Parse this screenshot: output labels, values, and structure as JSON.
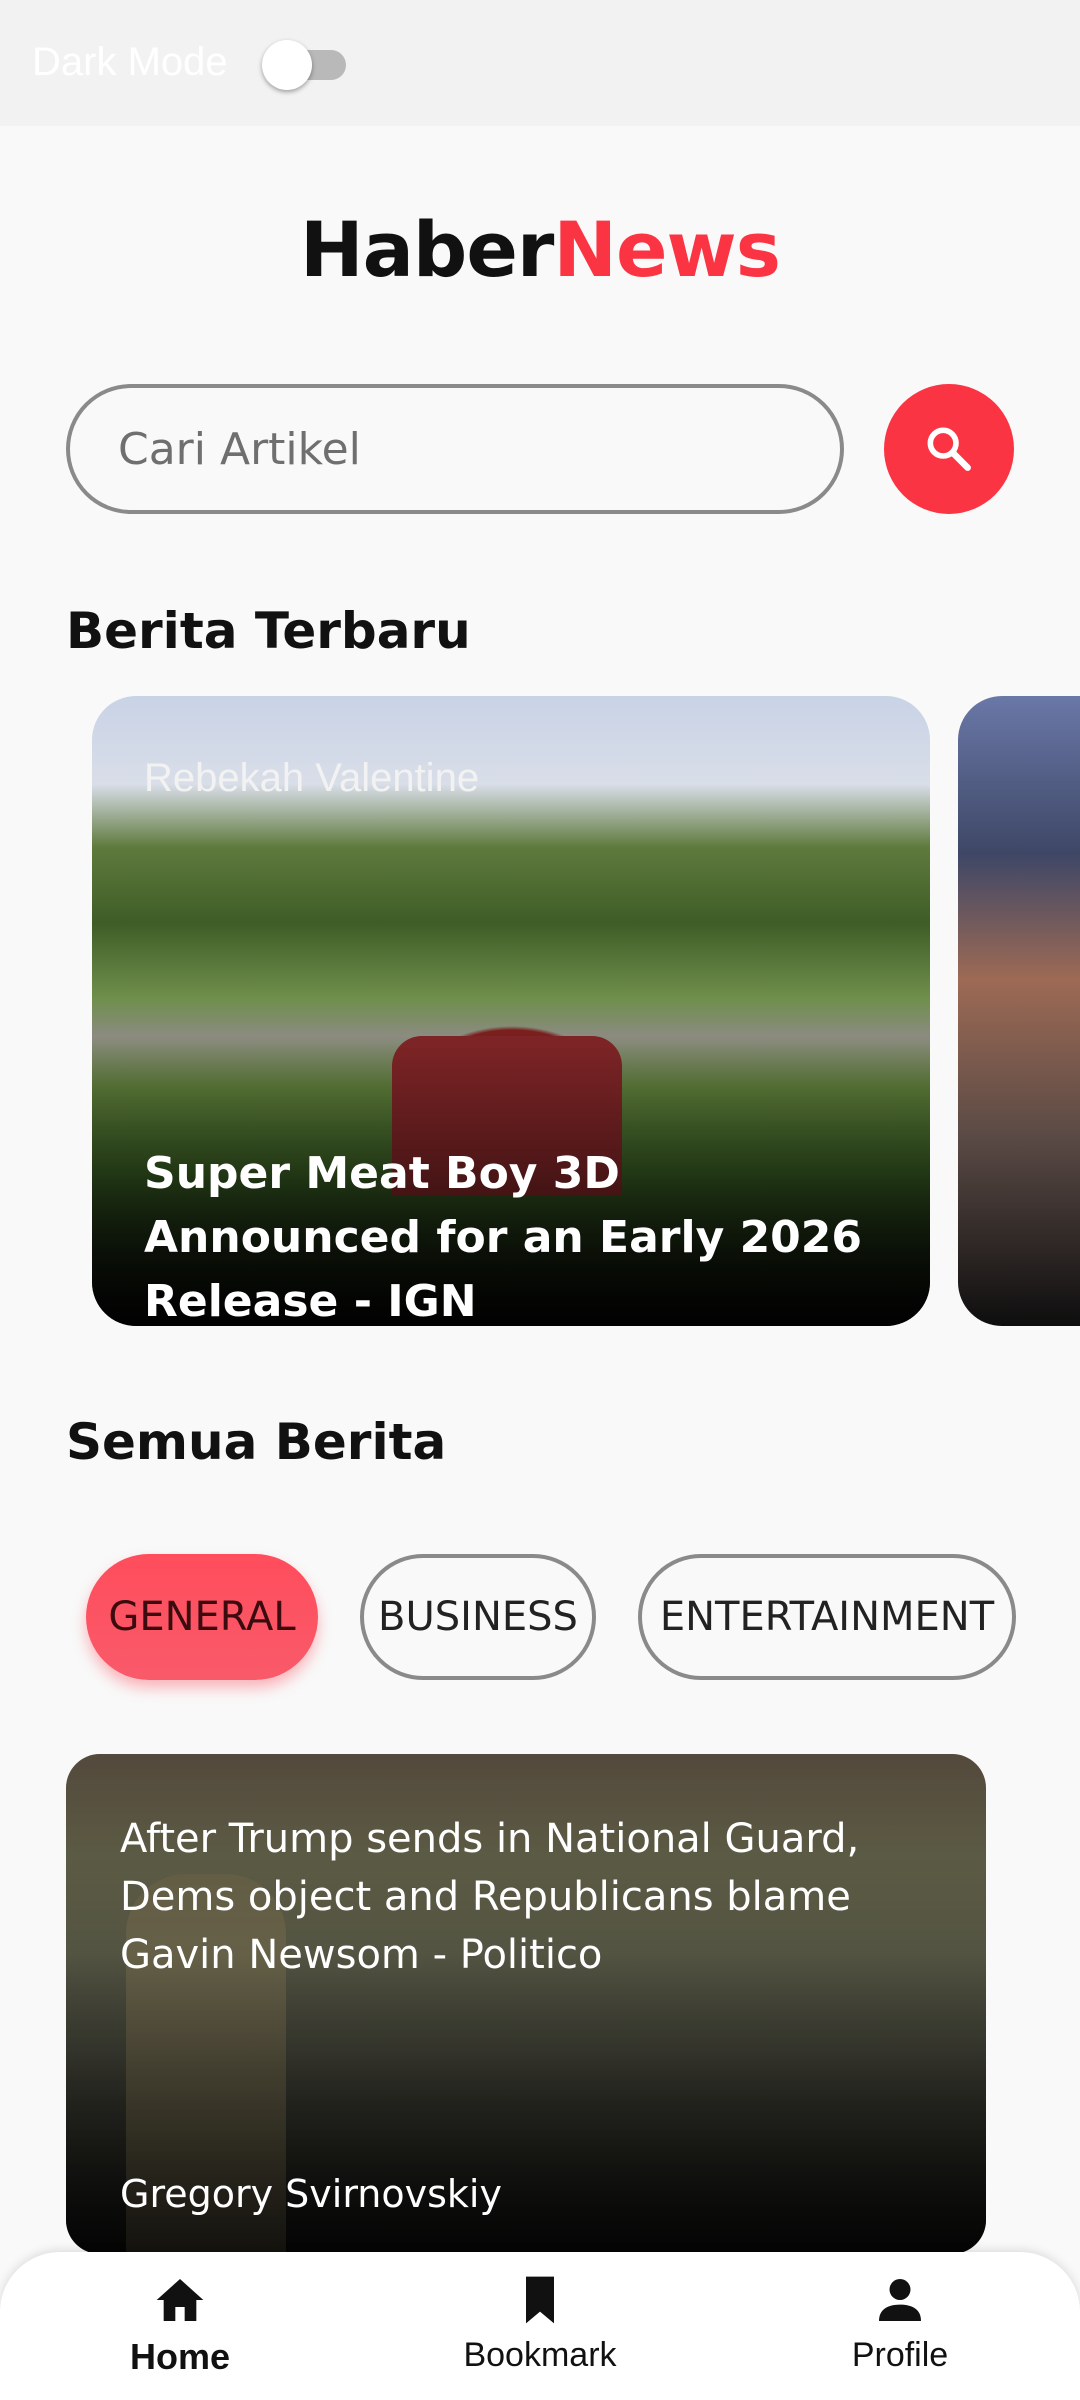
{
  "top_bar": {
    "dark_mode_label": "Dark Mode",
    "dark_mode_on": false
  },
  "logo": {
    "part1": "Haber",
    "part2": "News"
  },
  "search": {
    "placeholder": "Cari Artikel",
    "value": "",
    "icon": "search-icon"
  },
  "latest": {
    "title": "Berita Terbaru",
    "cards": [
      {
        "author": "Rebekah Valentine",
        "title": "Super Meat Boy 3D Announced for an Early 2026 Release - IGN"
      }
    ]
  },
  "all_news": {
    "title": "Semua Berita",
    "categories": [
      "GENERAL",
      "BUSINESS",
      "ENTERTAINMENT"
    ],
    "selected_category": "GENERAL",
    "articles": [
      {
        "title": "After Trump sends in National Guard, Dems object and Republicans blame Gavin Newsom - Politico",
        "author": "Gregory Svirnovskiy"
      }
    ]
  },
  "bottom_nav": {
    "items": [
      {
        "label": "Home",
        "icon": "home-icon",
        "active": true
      },
      {
        "label": "Bookmark",
        "icon": "bookmark-icon",
        "active": false
      },
      {
        "label": "Profile",
        "icon": "person-icon",
        "active": false
      }
    ]
  },
  "colors": {
    "accent": "#fb3444",
    "background": "#f9f9f9",
    "text": "#111111"
  }
}
